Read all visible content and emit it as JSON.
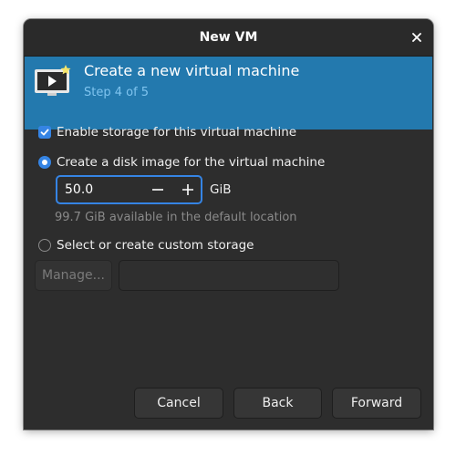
{
  "window": {
    "title": "New VM"
  },
  "banner": {
    "title": "Create a new virtual machine",
    "step": "Step 4 of 5",
    "icon": "vm-monitor-icon"
  },
  "storage": {
    "enable_label": "Enable storage for this virtual machine",
    "enable_checked": true,
    "create_disk_label": "Create a disk image for the virtual machine",
    "create_disk_selected": true,
    "size_value": "50.0",
    "size_unit": "GiB",
    "available_text": "99.7 GiB available in the default location",
    "custom_label": "Select or create custom storage",
    "custom_selected": false,
    "manage_label": "Manage...",
    "custom_path": ""
  },
  "footer": {
    "cancel_label": "Cancel",
    "back_label": "Back",
    "forward_label": "Forward"
  },
  "colors": {
    "accent": "#3584e4",
    "banner_bg": "#2379ae",
    "window_bg": "#2d2d2d"
  }
}
